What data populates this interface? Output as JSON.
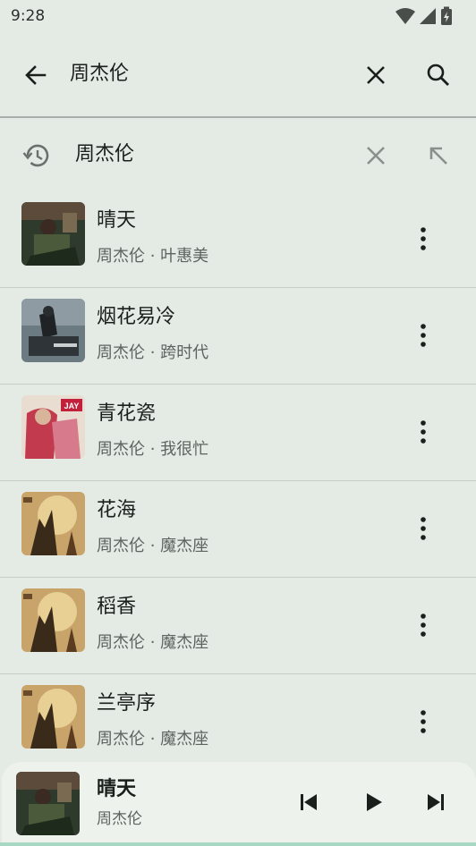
{
  "status_bar": {
    "time": "9:28"
  },
  "search": {
    "query": "周杰伦"
  },
  "suggestion": {
    "text": "周杰伦"
  },
  "songs": [
    {
      "title": "晴天",
      "subtitle": "周杰伦 · 叶惠美"
    },
    {
      "title": "烟花易冷",
      "subtitle": "周杰伦 · 跨时代"
    },
    {
      "title": "青花瓷",
      "subtitle": "周杰伦 · 我很忙"
    },
    {
      "title": "花海",
      "subtitle": "周杰伦 · 魔杰座"
    },
    {
      "title": "稻香",
      "subtitle": "周杰伦 · 魔杰座"
    },
    {
      "title": "兰亭序",
      "subtitle": "周杰伦 · 魔杰座"
    }
  ],
  "player": {
    "title": "晴天",
    "artist": "周杰伦"
  },
  "icons": {
    "back": "arrow-left-icon",
    "clear": "close-icon",
    "search": "search-icon",
    "history": "history-icon",
    "fill": "arrow-up-left-icon",
    "more": "more-vertical-icon",
    "prev": "skip-previous-icon",
    "play": "play-icon",
    "next": "skip-next-icon"
  },
  "colors": {
    "background": "#e4eae4",
    "player_bg": "#edf2ed",
    "accent": "#a8d7c3"
  },
  "album_badge": "JAY"
}
